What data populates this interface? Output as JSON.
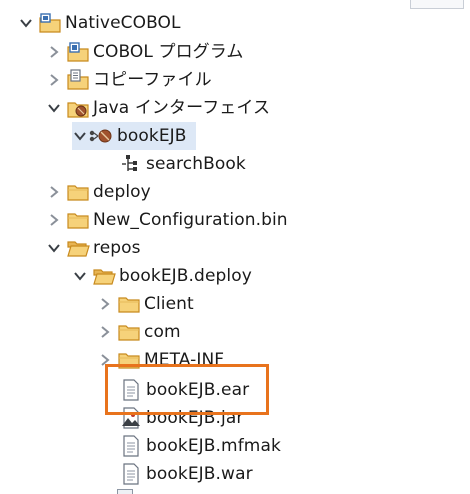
{
  "tree": {
    "items": [
      {
        "label": "NativeCOBOL",
        "icon": "cobol-project-icon",
        "expanded": true
      },
      {
        "label": "COBOL プログラム",
        "icon": "cobol-programs-folder-icon",
        "expanded": false
      },
      {
        "label": "コピーファイル",
        "icon": "copybooks-folder-icon",
        "expanded": false
      },
      {
        "label": "Java インターフェイス",
        "icon": "java-interface-folder-icon",
        "expanded": true
      },
      {
        "label": "bookEJB",
        "icon": "ejb-service-icon",
        "expanded": true,
        "selected": true
      },
      {
        "label": "searchBook",
        "icon": "operation-icon"
      },
      {
        "label": "deploy",
        "icon": "folder-icon",
        "expanded": false
      },
      {
        "label": "New_Configuration.bin",
        "icon": "folder-icon",
        "expanded": false
      },
      {
        "label": "repos",
        "icon": "folder-open-icon",
        "expanded": true
      },
      {
        "label": "bookEJB.deploy",
        "icon": "folder-open-icon",
        "expanded": true
      },
      {
        "label": "Client",
        "icon": "folder-icon",
        "expanded": false
      },
      {
        "label": "com",
        "icon": "folder-icon",
        "expanded": false
      },
      {
        "label": "META-INF",
        "icon": "folder-icon",
        "expanded": false
      },
      {
        "label": "bookEJB.ear",
        "icon": "file-icon",
        "highlighted": true
      },
      {
        "label": "bookEJB.jar",
        "icon": "jar-file-icon"
      },
      {
        "label": "bookEJB.mfmak",
        "icon": "file-icon"
      },
      {
        "label": "bookEJB.war",
        "icon": "file-icon"
      }
    ]
  },
  "colors": {
    "selection": "#dde8f6",
    "highlight_border": "#e8731d",
    "folder_fill": "#f6d27a",
    "folder_stroke": "#c88a1e"
  }
}
